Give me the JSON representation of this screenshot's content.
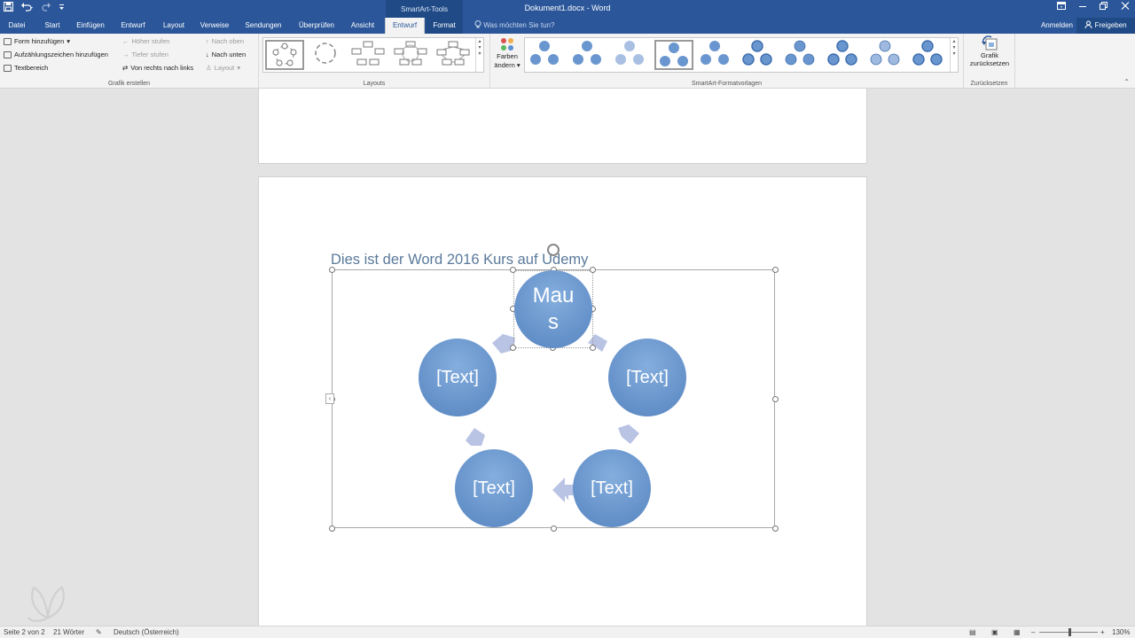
{
  "titlebar": {
    "contextual_group": "SmartArt-Tools",
    "document_title": "Dokument1.docx - Word"
  },
  "tabs": [
    {
      "label": "Datei",
      "x": 0
    },
    {
      "label": "Start"
    },
    {
      "label": "Einfügen"
    },
    {
      "label": "Entwurf"
    },
    {
      "label": "Layout"
    },
    {
      "label": "Verweise"
    },
    {
      "label": "Sendungen"
    },
    {
      "label": "Überprüfen"
    },
    {
      "label": "Ansicht"
    },
    {
      "label": "Entwurf"
    },
    {
      "label": "Format"
    }
  ],
  "tellme_placeholder": "Was möchten Sie tun?",
  "account": {
    "signin": "Anmelden",
    "share": "Freigeben"
  },
  "ribbon": {
    "create_graphic": {
      "add_shape": "Form hinzufügen",
      "add_bullet": "Aufzählungszeichen hinzufügen",
      "text_pane": "Textbereich",
      "promote": "Höher stufen",
      "demote": "Tiefer stufen",
      "right_to_left": "Von rechts nach links",
      "move_up": "Nach oben",
      "move_down": "Nach unten",
      "layout": "Layout",
      "group_label": "Grafik erstellen"
    },
    "layouts_label": "Layouts",
    "change_colors": {
      "line1": "Farben",
      "line2": "ändern"
    },
    "styles_label": "SmartArt-Formatvorlagen",
    "reset": {
      "line1": "Grafik",
      "line2": "zurücksetzen",
      "group_label": "Zurücksetzen"
    }
  },
  "document": {
    "heading": "Dies ist der Word 2016 Kurs auf Udemy",
    "smartart": {
      "top_node_line1": "Mau",
      "top_node_line2": "s",
      "node_right": "[Text]",
      "node_bottom_right": "[Text]",
      "node_bottom_left": "[Text]",
      "node_left": "[Text]"
    }
  },
  "statusbar": {
    "page": "Seite 2 von 2",
    "words": "21 Wörter",
    "language": "Deutsch (Österreich)",
    "zoom": "130%"
  },
  "colors": {
    "accent": "#2b579a",
    "node": "#6a96cf",
    "arrow": "#b9c3e4"
  }
}
